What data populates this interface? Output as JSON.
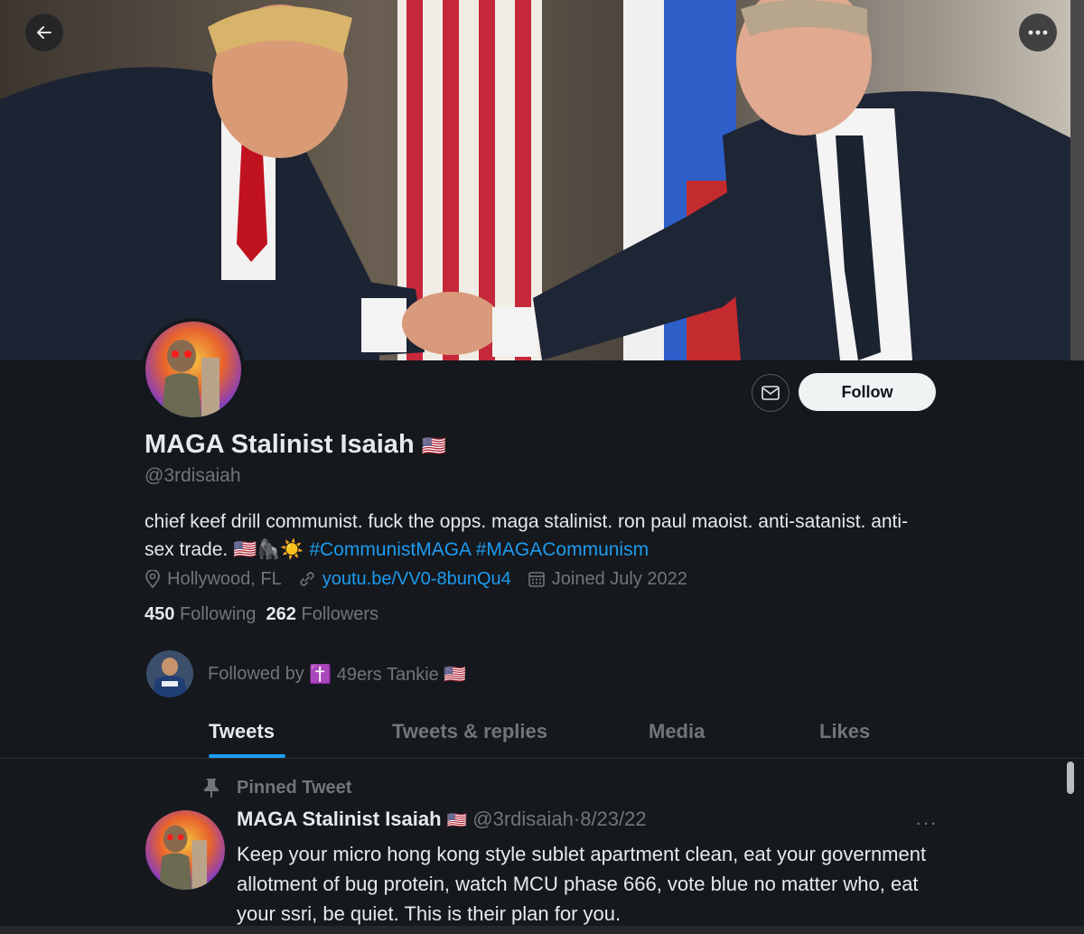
{
  "profile": {
    "display_name": "MAGA Stalinist Isaiah",
    "flag": "🇺🇸",
    "handle": "@3rdisaiah",
    "bio_text": "chief keef drill communist. fuck the opps. maga stalinist. ron paul maoist. anti-satanist. anti-sex trade. 🇺🇸🦍☀️ ",
    "bio_hashtags": "#CommunistMAGA #MAGACommunism",
    "location": "Hollywood, FL",
    "website": "youtu.be/VV0-8bunQu4",
    "joined": "Joined July 2022",
    "following_count": "450",
    "following_label": "Following",
    "followers_count": "262",
    "followers_label": "Followers",
    "followed_by_prefix": "Followed by",
    "followed_by_name": "✝️ 49ers Tankie 🇺🇸"
  },
  "actions": {
    "follow_label": "Follow"
  },
  "tabs": [
    {
      "label": "Tweets",
      "active": true
    },
    {
      "label": "Tweets & replies",
      "active": false
    },
    {
      "label": "Media",
      "active": false
    },
    {
      "label": "Likes",
      "active": false
    }
  ],
  "pinned_tweet": {
    "pinned_label": "Pinned Tweet",
    "author_name": "MAGA Stalinist Isaiah",
    "author_flag": "🇺🇸",
    "author_handle": "@3rdisaiah",
    "separator": "·",
    "date": "8/23/22",
    "more": "···",
    "text": "Keep your micro hong kong style sublet apartment clean, eat your government allotment of bug protein, watch MCU phase 666, vote blue no matter who, eat your ssri, be quiet. This is their plan for you."
  },
  "colors": {
    "accent": "#1d9bf0",
    "background": "#15181c",
    "text_primary": "#e7e9ea",
    "text_secondary": "#71767b"
  },
  "icons": [
    "back-arrow-icon",
    "more-icon",
    "envelope-icon",
    "location-pin-icon",
    "link-icon",
    "calendar-icon",
    "pin-icon"
  ]
}
